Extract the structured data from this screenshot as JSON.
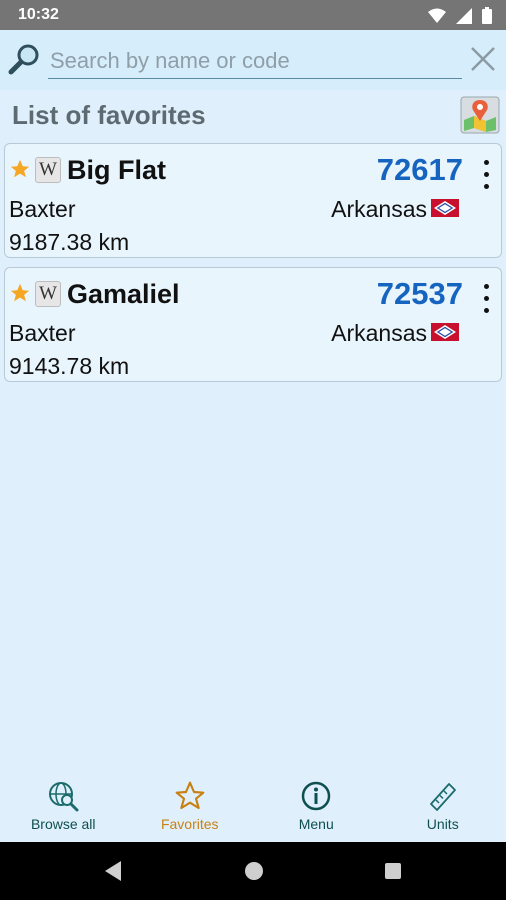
{
  "status_bar": {
    "time": "10:32",
    "icons": [
      "wifi-icon",
      "signal-icon",
      "battery-icon"
    ]
  },
  "search": {
    "placeholder": "Search by name or code",
    "value": ""
  },
  "list": {
    "title": "List of favorites",
    "items": [
      {
        "name": "Big Flat",
        "code": "72617",
        "county": "Baxter",
        "state": "Arkansas",
        "distance": "9187.38 km",
        "favorite": true,
        "wiki_badge": "W"
      },
      {
        "name": "Gamaliel",
        "code": "72537",
        "county": "Baxter",
        "state": "Arkansas",
        "distance": "9143.78 km",
        "favorite": true,
        "wiki_badge": "W"
      }
    ]
  },
  "bottom_nav": [
    {
      "label": "Browse all",
      "icon": "globe-search-icon",
      "active": false
    },
    {
      "label": "Favorites",
      "icon": "star-outline-icon",
      "active": true
    },
    {
      "label": "Menu",
      "icon": "info-circle-icon",
      "active": false
    },
    {
      "label": "Units",
      "icon": "ruler-icon",
      "active": false
    }
  ],
  "colors": {
    "background": "#dff0fc",
    "code": "#1565c0",
    "active_nav": "#c98012",
    "nav": "#0f4f4f",
    "star": "#f5a623"
  }
}
